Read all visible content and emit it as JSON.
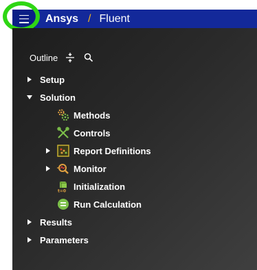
{
  "header": {
    "brand": "Ansys",
    "separator": "/",
    "product": "Fluent",
    "menu_icon": "hamburger-menu-icon",
    "highlight_color": "#2fd614"
  },
  "outline": {
    "title": "Outline",
    "tools": [
      "split-icon",
      "search-icon"
    ]
  },
  "tree": {
    "setup": {
      "label": "Setup",
      "expanded": false
    },
    "solution": {
      "label": "Solution",
      "expanded": true,
      "children": [
        {
          "label": "Methods",
          "icon": "methods-gears-icon"
        },
        {
          "label": "Controls",
          "icon": "controls-tools-icon"
        },
        {
          "label": "Report Definitions",
          "icon": "report-definitions-icon",
          "expandable": true
        },
        {
          "label": "Monitor",
          "icon": "monitor-magnifier-icon",
          "expandable": true
        },
        {
          "label": "Initialization",
          "icon": "initialization-icon"
        },
        {
          "label": "Run Calculation",
          "icon": "run-calculation-icon"
        }
      ]
    },
    "results": {
      "label": "Results",
      "expanded": false
    },
    "parameters": {
      "label": "Parameters",
      "expanded": false
    }
  },
  "colors": {
    "header_bg": "#13299a",
    "accent": "#f2b321",
    "panel_bg": "#2a2a2a"
  }
}
